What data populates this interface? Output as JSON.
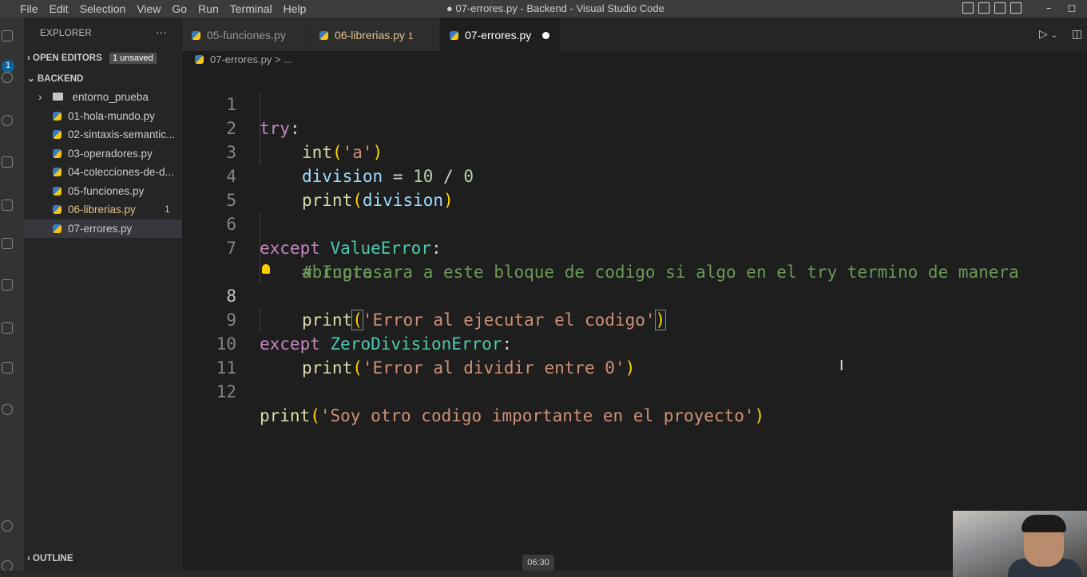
{
  "menu": [
    "File",
    "Edit",
    "Selection",
    "View",
    "Go",
    "Run",
    "Terminal",
    "Help"
  ],
  "window_title": "● 07-errores.py - Backend - Visual Studio Code",
  "window_controls": {
    "minimize": "–",
    "maximize": "◻"
  },
  "activity_badge": "1",
  "explorer": {
    "title": "EXPLORER",
    "more": "···",
    "open_editors": "OPEN EDITORS",
    "unsaved": "1 unsaved",
    "folder": "BACKEND",
    "outline": "OUTLINE",
    "items": [
      {
        "label": "entorno_prueba",
        "type": "folder"
      },
      {
        "label": "01-hola-mundo.py",
        "type": "py"
      },
      {
        "label": "02-sintaxis-semantic...",
        "type": "py"
      },
      {
        "label": "03-operadores.py",
        "type": "py"
      },
      {
        "label": "04-colecciones-de-d...",
        "type": "py"
      },
      {
        "label": "05-funciones.py",
        "type": "py"
      },
      {
        "label": "06-librerias.py",
        "type": "py",
        "count": "1"
      },
      {
        "label": "07-errores.py",
        "type": "py"
      }
    ]
  },
  "tabs": [
    {
      "label": "05-funciones.py"
    },
    {
      "label": "06-librerias.py",
      "count": "1"
    },
    {
      "label": "07-errores.py"
    }
  ],
  "breadcrumb": "07-errores.py > ...",
  "code_lines": [
    {
      "n": "1",
      "text": "try:"
    },
    {
      "n": "2",
      "text": "int('a')"
    },
    {
      "n": "3",
      "text": "division = 10 / 0"
    },
    {
      "n": "4",
      "text": "print(division)"
    },
    {
      "n": "5",
      "text": ""
    },
    {
      "n": "6",
      "text": "except ValueError:"
    },
    {
      "n": "7",
      "text": "# Ingresara a este bloque de codigo si algo en el try termino de manera"
    },
    {
      "n": "",
      "text": "abrupta"
    },
    {
      "n": "8",
      "text": "print('Error al ejecutar el codigo')"
    },
    {
      "n": "9",
      "text": "except ZeroDivisionError:"
    },
    {
      "n": "10",
      "text": "print('Error al dividir entre 0')"
    },
    {
      "n": "11",
      "text": ""
    },
    {
      "n": "12",
      "text": "print('Soy otro codigo importante en el proyecto')"
    }
  ],
  "video_timestamp": "06:30",
  "colors": {
    "keyword": "#c586c0",
    "function": "#dcdcaa",
    "variable": "#9cdcfe",
    "string": "#ce9178",
    "class": "#4ec9b0",
    "comment": "#6a9955",
    "modified": "#e2c08d"
  }
}
